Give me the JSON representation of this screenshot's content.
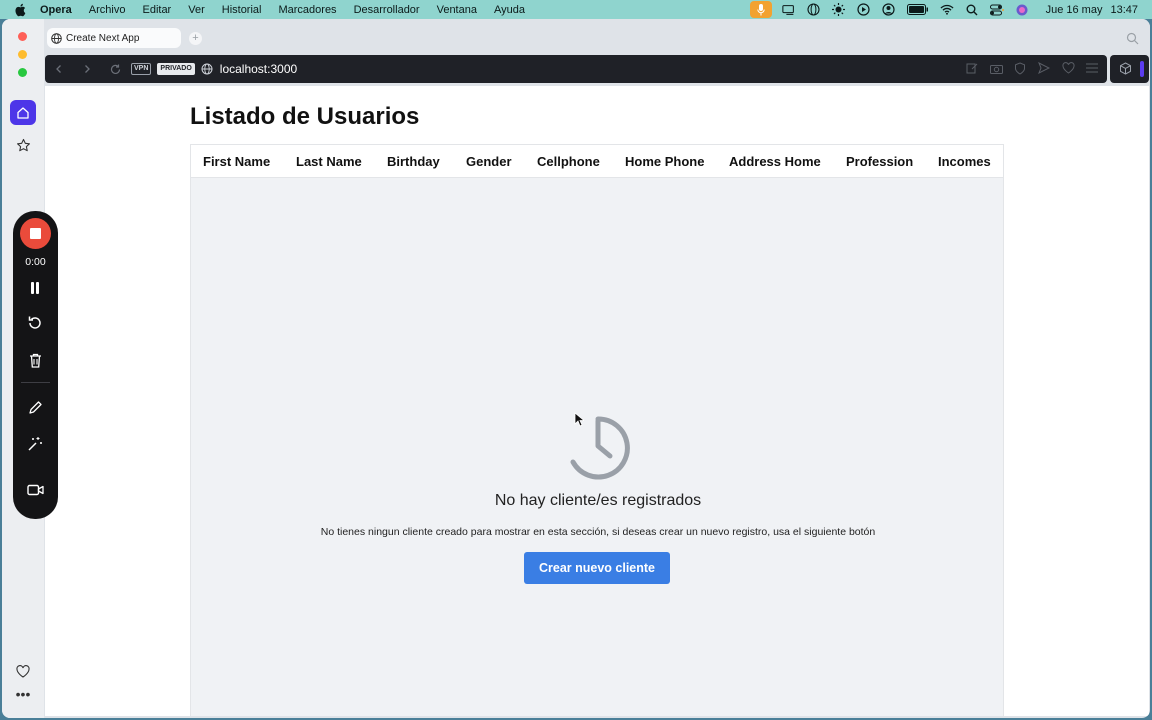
{
  "menubar": {
    "app_name": "Opera",
    "items": [
      "Archivo",
      "Editar",
      "Ver",
      "Historial",
      "Marcadores",
      "Desarrollador",
      "Ventana",
      "Ayuda"
    ],
    "date": "Jue 16 may",
    "time": "13:47"
  },
  "browser": {
    "tab_title": "Create Next App",
    "new_tab_symbol": "+",
    "vpn_badge": "VPN",
    "private_badge": "PRIVADO",
    "url": "localhost:3000"
  },
  "page": {
    "title": "Listado de Usuarios",
    "columns": [
      "First Name",
      "Last Name",
      "Birthday",
      "Gender",
      "Cellphone",
      "Home Phone",
      "Address Home",
      "Profession",
      "Incomes"
    ],
    "empty_title": "No hay cliente/es registrados",
    "empty_text": "No tienes ningun cliente creado para mostrar en esta sección, si deseas crear un nuevo registro, usa el siguiente botón",
    "create_button": "Crear nuevo cliente"
  },
  "recorder": {
    "timer": "0:00"
  },
  "sidebar": {
    "more": "•••"
  },
  "colors": {
    "menubar": "#8fd4ce",
    "accent": "#3a7ee4",
    "record": "#ea4b3b",
    "sidebar_home": "#4d36e8"
  }
}
